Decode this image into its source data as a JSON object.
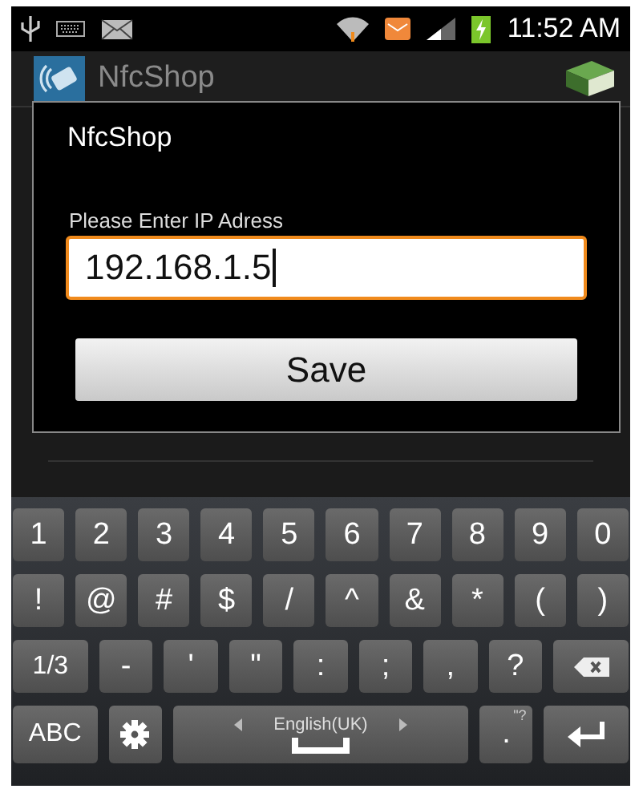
{
  "status_bar": {
    "time": "11:52 AM"
  },
  "app_bar": {
    "title": "NfcShop"
  },
  "dialog": {
    "title": "NfcShop",
    "label": "Please Enter IP Adress",
    "input": {
      "value": "192.168.1.5",
      "focused": true
    },
    "button": "Save"
  },
  "keyboard": {
    "rows": [
      {
        "keys": [
          {
            "kind": "char",
            "label": "1"
          },
          {
            "kind": "char",
            "label": "2"
          },
          {
            "kind": "char",
            "label": "3"
          },
          {
            "kind": "char",
            "label": "4"
          },
          {
            "kind": "char",
            "label": "5"
          },
          {
            "kind": "char",
            "label": "6"
          },
          {
            "kind": "char",
            "label": "7"
          },
          {
            "kind": "char",
            "label": "8"
          },
          {
            "kind": "char",
            "label": "9"
          },
          {
            "kind": "char",
            "label": "0"
          }
        ]
      },
      {
        "keys": [
          {
            "kind": "char",
            "label": "!"
          },
          {
            "kind": "char",
            "label": "@"
          },
          {
            "kind": "char",
            "label": "#"
          },
          {
            "kind": "char",
            "label": "$"
          },
          {
            "kind": "char",
            "label": "/"
          },
          {
            "kind": "char",
            "label": "^"
          },
          {
            "kind": "char",
            "label": "&"
          },
          {
            "kind": "char",
            "label": "*"
          },
          {
            "kind": "char",
            "label": "("
          },
          {
            "kind": "char",
            "label": ")"
          }
        ]
      },
      {
        "keys": [
          {
            "kind": "wide",
            "label": "1/3"
          },
          {
            "kind": "char",
            "label": "-"
          },
          {
            "kind": "char",
            "label": "'"
          },
          {
            "kind": "char",
            "label": "\""
          },
          {
            "kind": "char",
            "label": ":"
          },
          {
            "kind": "char",
            "label": ";"
          },
          {
            "kind": "char",
            "label": ","
          },
          {
            "kind": "char",
            "label": "?"
          },
          {
            "kind": "backspace"
          }
        ]
      },
      {
        "keys": [
          {
            "kind": "mode",
            "label": "ABC"
          },
          {
            "kind": "settings"
          },
          {
            "kind": "space",
            "label": "English(UK)"
          },
          {
            "kind": "char",
            "label": ".",
            "hint": "\"?"
          },
          {
            "kind": "enter"
          }
        ]
      }
    ]
  }
}
